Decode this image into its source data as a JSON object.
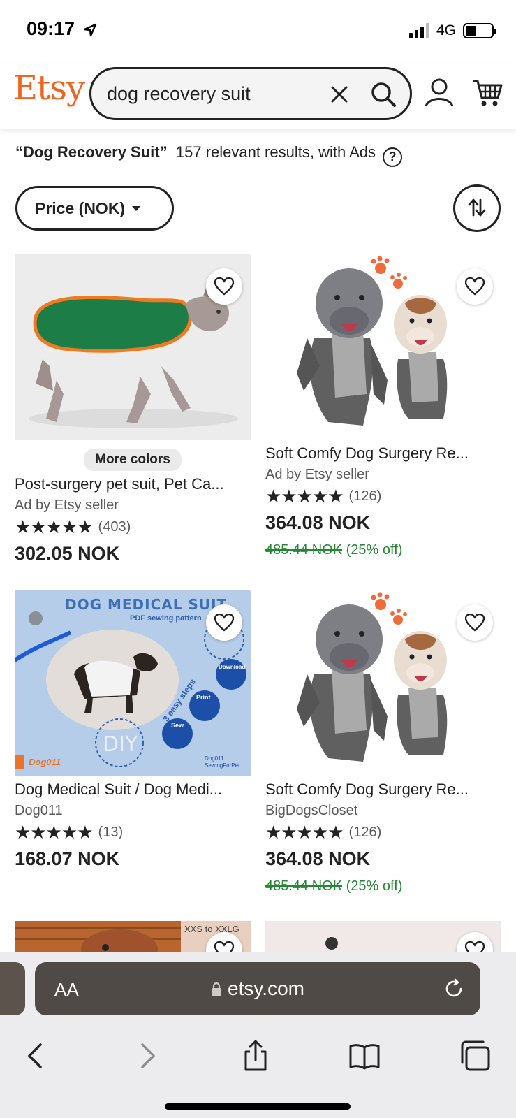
{
  "status": {
    "time": "09:17",
    "network": "4G"
  },
  "header": {
    "logo": "Etsy",
    "search_value": "dog recovery suit"
  },
  "results": {
    "query": "“Dog Recovery Suit”",
    "summary": "157 relevant results, with Ads"
  },
  "filters": {
    "price_label": "Price (NOK)"
  },
  "listings": [
    {
      "badge": "More colors",
      "title": "Post-surgery pet suit, Pet Ca...",
      "seller": "Ad by Etsy seller",
      "stars": "★★★★★",
      "reviews": "(403)",
      "price": "302.05 NOK",
      "old_price": "",
      "discount": ""
    },
    {
      "badge": "",
      "title": "Soft Comfy Dog Surgery Re...",
      "seller": "Ad by Etsy seller",
      "stars": "★★★★★",
      "reviews": "(126)",
      "price": "364.08 NOK",
      "old_price": "485.44 NOK",
      "discount": "(25% off)"
    },
    {
      "badge": "",
      "title": "Dog Medical Suit / Dog Medi...",
      "seller": "Dog011",
      "stars": "★★★★★",
      "reviews": "(13)",
      "price": "168.07 NOK",
      "old_price": "",
      "discount": "",
      "image_text": {
        "heading": "DOG MEDICAL SUIT",
        "sub": "PDF sewing pattern",
        "diy": "DIY",
        "steps": "3 easy steps",
        "print": "Print",
        "sew": "Sew",
        "download": "Download",
        "shop": "Dog011",
        "shop_footer": "Dog011 SewingForPet"
      }
    },
    {
      "badge": "",
      "title": "Soft Comfy Dog Surgery Re...",
      "seller": "BigDogsCloset",
      "stars": "★★★★★",
      "reviews": "(126)",
      "price": "364.08 NOK",
      "old_price": "485.44 NOK",
      "discount": "(25% off)"
    }
  ],
  "peek": {
    "size_text": "XXS to XXLG"
  },
  "browser": {
    "text_size": "AA",
    "url": "etsy.com"
  },
  "colors": {
    "brand": "#F1641E",
    "discount": "#258635"
  }
}
